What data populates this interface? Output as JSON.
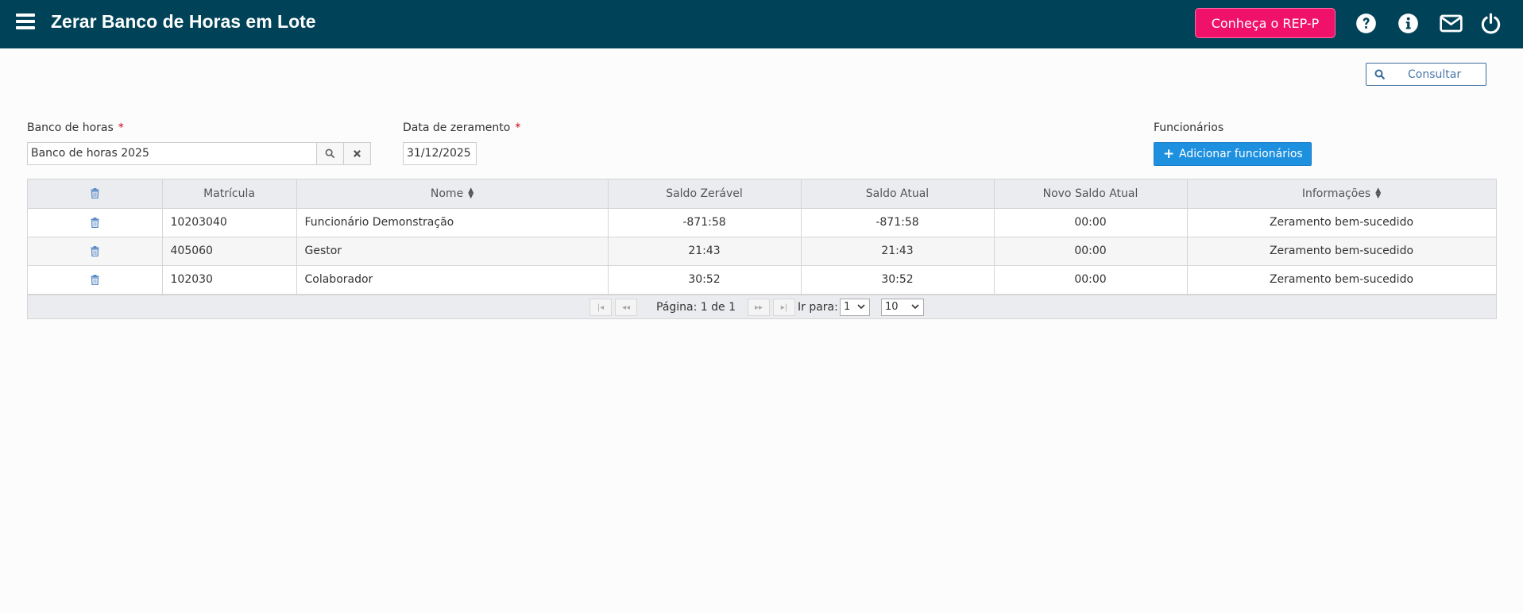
{
  "header": {
    "title": "Zerar Banco de Horas em Lote",
    "rep_button": "Conheça o REP-P",
    "icons": [
      "menu-icon",
      "help-icon",
      "info-icon",
      "mail-icon",
      "power-icon"
    ],
    "background": "#004359",
    "rep_color": "#f0116b"
  },
  "toolbar": {
    "consultar_label": "Consultar"
  },
  "form": {
    "banco_label": "Banco de horas",
    "banco_value": "Banco de horas 2025",
    "data_label": "Data de zeramento",
    "data_value": "31/12/2025",
    "required_mark": "*",
    "funcionarios_label": "Funcionários",
    "add_button": "Adicionar funcionários"
  },
  "table": {
    "columns": [
      "Matrícula",
      "Nome",
      "Saldo Zerável",
      "Saldo Atual",
      "Novo Saldo Atual",
      "Informações"
    ],
    "rows": [
      {
        "matricula": "10203040",
        "nome": "Funcionário Demonstração",
        "saldo_zeravel": "-871:58",
        "saldo_atual": "-871:58",
        "novo_saldo": "00:00",
        "info": "Zeramento bem-sucedido"
      },
      {
        "matricula": "405060",
        "nome": "Gestor",
        "saldo_zeravel": "21:43",
        "saldo_atual": "21:43",
        "novo_saldo": "00:00",
        "info": "Zeramento bem-sucedido"
      },
      {
        "matricula": "102030",
        "nome": "Colaborador",
        "saldo_zeravel": "30:52",
        "saldo_atual": "30:52",
        "novo_saldo": "00:00",
        "info": "Zeramento bem-sucedido"
      }
    ]
  },
  "pager": {
    "page_text": "Página: 1 de 1",
    "goto_label": "Ir para:",
    "goto_value": "1",
    "page_size": "10"
  }
}
